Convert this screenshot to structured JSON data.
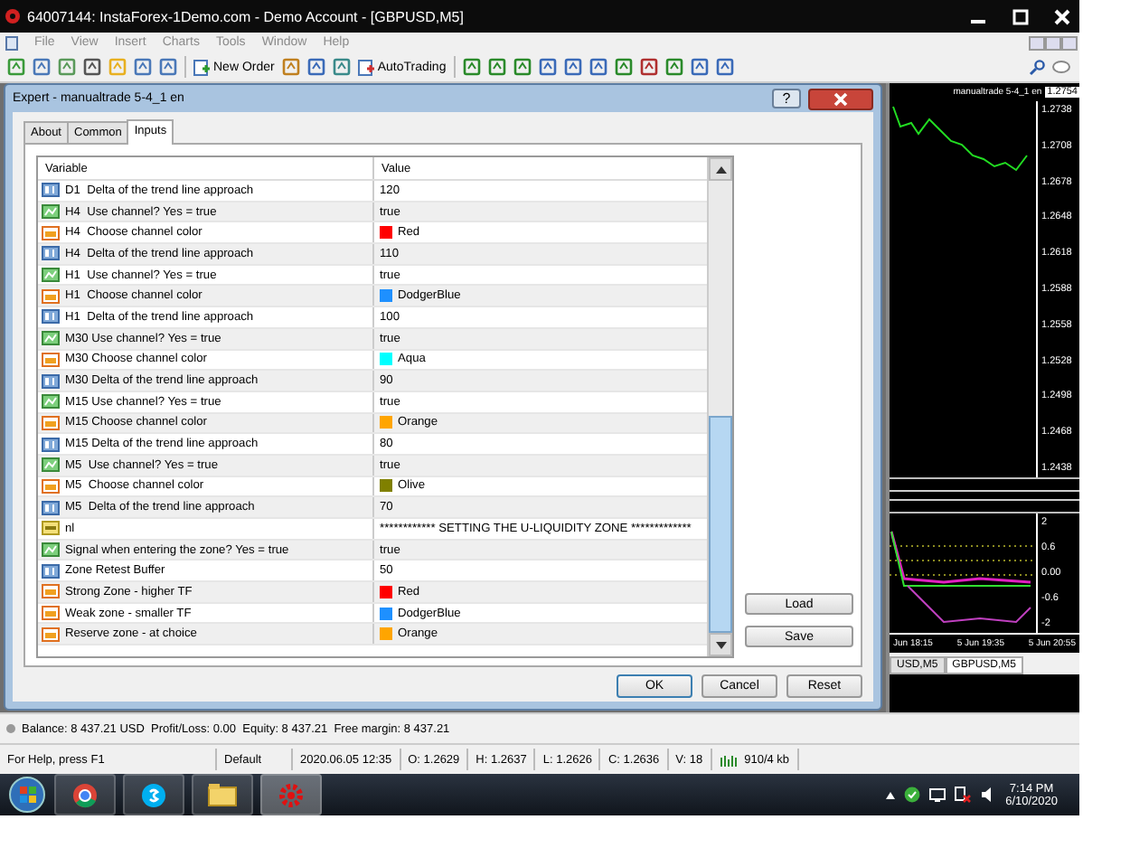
{
  "window": {
    "title": "64007144: InstaForex-1Demo.com - Demo Account - [GBPUSD,M5]"
  },
  "menu": [
    "File",
    "View",
    "Insert",
    "Charts",
    "Tools",
    "Window",
    "Help"
  ],
  "toolbar": {
    "buttons": [
      {
        "label": "New Order"
      },
      {
        "label": "AutoTrading"
      }
    ]
  },
  "chart": {
    "indicator_label": "manualtrade 5-4_1 en",
    "current_price": "1.2754",
    "price_axis": [
      "1.2738",
      "1.2708",
      "1.2678",
      "1.2648",
      "1.2618",
      "1.2588",
      "1.2558",
      "1.2528",
      "1.2498",
      "1.2468",
      "1.2438"
    ],
    "indicator_axis": [
      "2",
      "0.6",
      "0.00",
      "-0.6",
      "-2"
    ],
    "time_axis": [
      "Jun 18:15",
      "5 Jun 19:35",
      "5 Jun 20:55"
    ],
    "tabs": [
      {
        "label": "USD,M5",
        "selected": false
      },
      {
        "label": "GBPUSD,M5",
        "selected": true
      }
    ]
  },
  "dialog": {
    "title": "Expert - manualtrade 5-4_1 en",
    "help": "?",
    "tabs": [
      {
        "label": "About",
        "selected": false
      },
      {
        "label": "Common",
        "selected": false
      },
      {
        "label": "Inputs",
        "selected": true
      }
    ],
    "columns": [
      "Variable",
      "Value"
    ],
    "rows": [
      {
        "kind": "number",
        "variable": "D1  Delta of the trend line approach",
        "value": "120"
      },
      {
        "kind": "bool",
        "variable": "H4  Use channel? Yes = true",
        "value": "true"
      },
      {
        "kind": "color",
        "variable": "H4  Choose channel color",
        "value": "Red",
        "color": "#ff0000"
      },
      {
        "kind": "number",
        "variable": "H4  Delta of the trend line approach",
        "value": "110"
      },
      {
        "kind": "bool",
        "variable": "H1  Use channel? Yes = true",
        "value": "true"
      },
      {
        "kind": "color",
        "variable": "H1  Choose channel color",
        "value": "DodgerBlue",
        "color": "#1e90ff"
      },
      {
        "kind": "number",
        "variable": "H1  Delta of the trend line approach",
        "value": "100"
      },
      {
        "kind": "bool",
        "variable": "M30 Use channel? Yes = true",
        "value": "true"
      },
      {
        "kind": "color",
        "variable": "M30 Choose channel color",
        "value": "Aqua",
        "color": "#00ffff"
      },
      {
        "kind": "number",
        "variable": "M30 Delta of the trend line approach",
        "value": "90"
      },
      {
        "kind": "bool",
        "variable": "M15 Use channel? Yes = true",
        "value": "true"
      },
      {
        "kind": "color",
        "variable": "M15 Choose channel color",
        "value": "Orange",
        "color": "#ffa500"
      },
      {
        "kind": "number",
        "variable": "M15 Delta of the trend line approach",
        "value": "80"
      },
      {
        "kind": "bool",
        "variable": "M5  Use channel? Yes = true",
        "value": "true"
      },
      {
        "kind": "color",
        "variable": "M5  Choose channel color",
        "value": "Olive",
        "color": "#808000"
      },
      {
        "kind": "number",
        "variable": "M5  Delta of the trend line approach",
        "value": "70"
      },
      {
        "kind": "text",
        "variable": "nl",
        "value": "************ SETTING THE U-LIQUIDITY ZONE *************"
      },
      {
        "kind": "bool",
        "variable": "Signal when entering the zone? Yes = true",
        "value": "true"
      },
      {
        "kind": "number",
        "variable": "Zone Retest Buffer",
        "value": "50"
      },
      {
        "kind": "color",
        "variable": "Strong Zone - higher TF",
        "value": "Red",
        "color": "#ff0000"
      },
      {
        "kind": "color",
        "variable": "Weak zone - smaller TF",
        "value": "DodgerBlue",
        "color": "#1e90ff"
      },
      {
        "kind": "color",
        "variable": "Reserve zone - at choice",
        "value": "Orange",
        "color": "#ffa500"
      }
    ],
    "side_buttons": [
      "Load",
      "Save"
    ],
    "buttons": [
      "OK",
      "Cancel",
      "Reset"
    ]
  },
  "account_bar": "Balance: 8 437.21 USD  Profit/Loss: 0.00  Equity: 8 437.21  Free margin: 8 437.21",
  "status_bar": [
    "For Help, press F1",
    "Default",
    "2020.06.05 12:35",
    "O: 1.2629",
    "H: 1.2637",
    "L: 1.2626",
    "C: 1.2636",
    "V: 18",
    "910/4 kb"
  ],
  "taskbar": {
    "time": "7:14 PM",
    "date": "6/10/2020"
  }
}
